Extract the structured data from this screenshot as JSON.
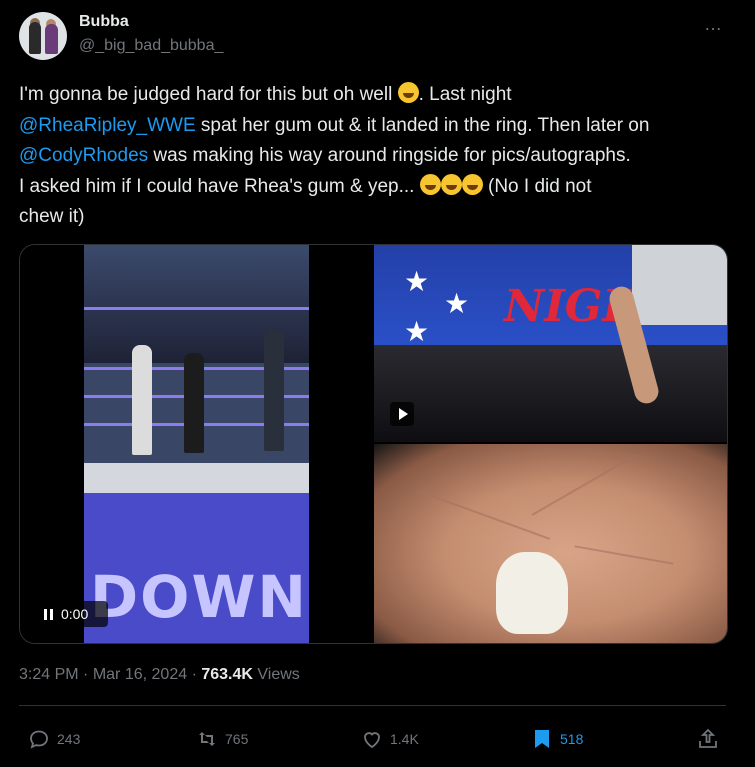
{
  "author": {
    "name": "Bubba",
    "handle": "@_big_bad_bubba_"
  },
  "more_icon": "…",
  "tweet": {
    "line1_a": "I'm gonna be judged hard for this but oh well ",
    "line1_b": ". Last night",
    "mention1": "@RheaRipley_WWE",
    "line2": " spat her gum out & it landed in the ring. Then later on",
    "mention2": "@CodyRhodes",
    "line3": " was making his way around ringside for pics/autographs.",
    "line4": "I asked him if I could have Rhea's gum & yep... ",
    "line4_b": " (No I did not",
    "line5": "chew it)"
  },
  "media": {
    "video_time": "0:00",
    "video_banner_text": "DOWN",
    "sign_text": "NIGHT"
  },
  "meta": {
    "time": "3:24 PM",
    "date": "Mar 16, 2024",
    "views": "763.4K",
    "views_label": "Views",
    "sep": "·"
  },
  "actions": {
    "replies": "243",
    "reposts": "765",
    "likes": "1.4K",
    "bookmarks": "518"
  },
  "colors": {
    "accent": "#1d9bf0",
    "text": "#e7e9ea",
    "muted": "#71767b",
    "background": "#000000"
  }
}
